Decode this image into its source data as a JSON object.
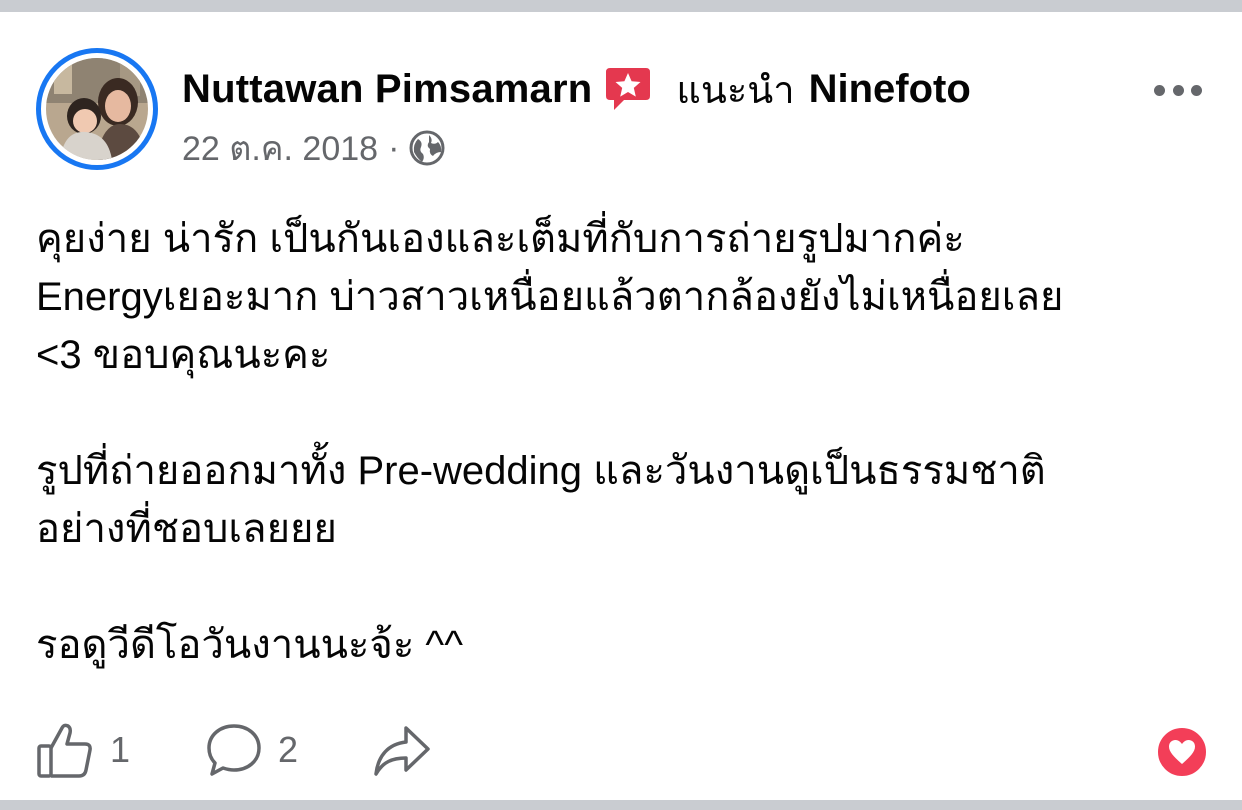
{
  "post": {
    "author": "Nuttawan Pimsamarn",
    "recommend_label": "แนะนำ",
    "page_name": "Ninefoto",
    "date": "22 ต.ค. 2018",
    "separator": "·",
    "privacy_icon": "globe-icon",
    "body_lines": [
      "คุยง่าย น่ารัก เป็นกันเองและเต็มที่กับการถ่ายรูปมากค่ะ",
      "Energyเยอะมาก บ่าวสาวเหนื่อยแล้วตากล้องยังไม่เหนื่อยเลย",
      "<3 ขอบคุณนะคะ",
      "รูปที่ถ่ายออกมาทั้ง Pre-wedding และวันงานดูเป็นธรรมชาติ",
      "อย่างที่ชอบเลยยย",
      "รอดูวีดีโอวันงานนะจ้ะ ^^"
    ]
  },
  "actions": {
    "like_count": "1",
    "comment_count": "2"
  },
  "icons": {
    "recommend": "recommend-star-icon",
    "like": "thumbs-up-icon",
    "comment": "comment-bubble-icon",
    "share": "share-arrow-icon",
    "reaction": "love-heart-icon",
    "more": "more-options-icon"
  },
  "colors": {
    "accent": "#1877f2",
    "recommend": "#e4384f",
    "love": "#f33e58",
    "text": "#050505",
    "secondary": "#65676b"
  }
}
